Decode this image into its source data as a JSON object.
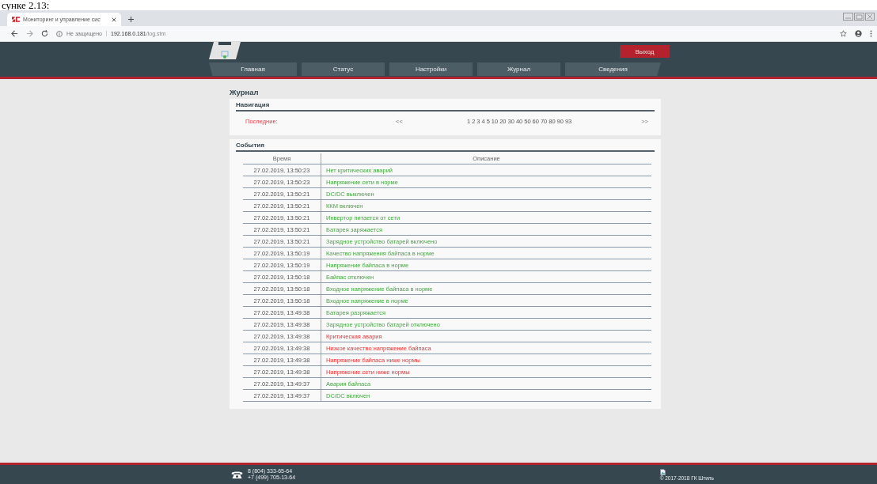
{
  "document_caption": "сунке 2.13:",
  "browser": {
    "tab_title": "Мониторинг и управление сис",
    "security": "Не защищено",
    "url_host": "192.168.0.181",
    "url_path": "/log.stm"
  },
  "header": {
    "logout": "Выход",
    "nav": [
      {
        "label": "Главная",
        "selected": false
      },
      {
        "label": "Статус",
        "selected": false
      },
      {
        "label": "Настройки",
        "selected": false
      },
      {
        "label": "Журнал",
        "selected": false
      },
      {
        "label": "Сведения",
        "selected": false
      }
    ]
  },
  "page_title": "Журнал",
  "navigation": {
    "title": "Навигация",
    "last_label": "Последние:",
    "prev": "<<",
    "pages": [
      "1",
      "2",
      "3",
      "4",
      "5",
      "10",
      "20",
      "30",
      "40",
      "50",
      "60",
      "70",
      "80",
      "90",
      "93"
    ],
    "next": ">>"
  },
  "events": {
    "title": "События",
    "columns": [
      "Время",
      "Описание"
    ],
    "rows": [
      {
        "time": "27.02.2019, 13:50:23",
        "description": "Нет критических аварий",
        "kind": "normal"
      },
      {
        "time": "27.02.2019, 13:50:23",
        "description": "Напряжение сети в норме",
        "kind": "normal"
      },
      {
        "time": "27.02.2019, 13:50:21",
        "description": "DC/DC выключен",
        "kind": "normal"
      },
      {
        "time": "27.02.2019, 13:50:21",
        "description": "ККМ включен",
        "kind": "normal"
      },
      {
        "time": "27.02.2019, 13:50:21",
        "description": "Инвертор питается от сети",
        "kind": "normal"
      },
      {
        "time": "27.02.2019, 13:50:21",
        "description": "Батарея заряжается",
        "kind": "normal"
      },
      {
        "time": "27.02.2019, 13:50:21",
        "description": "Зарядное устройство батарей включено",
        "kind": "normal"
      },
      {
        "time": "27.02.2019, 13:50:19",
        "description": "Качество напряжения байпаса в норме",
        "kind": "normal"
      },
      {
        "time": "27.02.2019, 13:50:19",
        "description": "Напряжение байпаса в норме",
        "kind": "normal"
      },
      {
        "time": "27.02.2019, 13:50:18",
        "description": "Байпас отключен",
        "kind": "normal"
      },
      {
        "time": "27.02.2019, 13:50:18",
        "description": "Входное напряжение байпаса в норме",
        "kind": "normal"
      },
      {
        "time": "27.02.2019, 13:50:18",
        "description": "Входное напряжение в норме",
        "kind": "normal"
      },
      {
        "time": "27.02.2019, 13:49:38",
        "description": "Батарея разряжается",
        "kind": "normal"
      },
      {
        "time": "27.02.2019, 13:49:38",
        "description": "Зарядное устройство батарей отключено",
        "kind": "normal"
      },
      {
        "time": "27.02.2019, 13:49:38",
        "description": "Критическая авария",
        "kind": "alarm"
      },
      {
        "time": "27.02.2019, 13:49:38",
        "description": "Низкое качество напряжение байпаса",
        "kind": "alarm"
      },
      {
        "time": "27.02.2019, 13:49:38",
        "description": "Напряжение байпаса ниже нормы",
        "kind": "alarm"
      },
      {
        "time": "27.02.2019, 13:49:38",
        "description": "Напряжение сети ниже нормы",
        "kind": "alarm"
      },
      {
        "time": "27.02.2019, 13:49:37",
        "description": "Авария байпаса",
        "kind": "normal"
      },
      {
        "time": "27.02.2019, 13:49:37",
        "description": "DC/DC включен",
        "kind": "normal"
      }
    ]
  },
  "footer": {
    "phones": [
      "8  (804) 333-65-64",
      "+7 (499) 705-13-64"
    ],
    "copyright": "© 2017-2018 ГК Штиль"
  }
}
